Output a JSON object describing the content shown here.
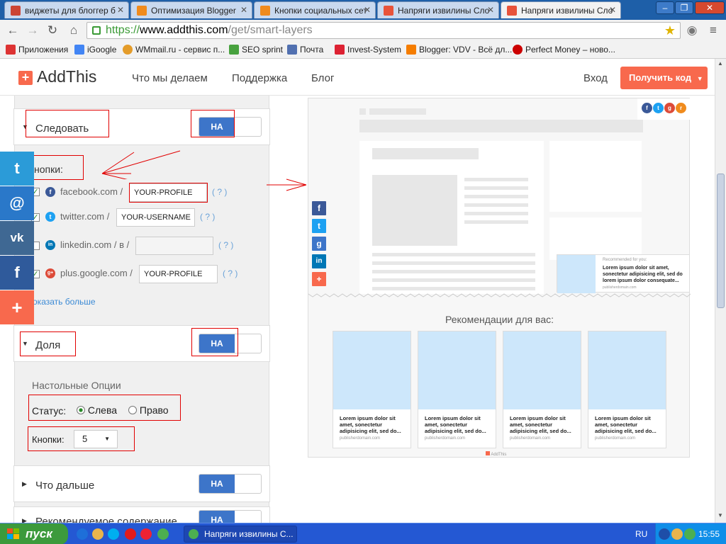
{
  "browser": {
    "tabs": [
      {
        "label": "виджеты для блоггер б",
        "fav": "#c43"
      },
      {
        "label": "Оптимизация Blogger",
        "fav": "#f08b1d"
      },
      {
        "label": "Кнопки социальных сет",
        "fav": "#f08b1d"
      },
      {
        "label": "Напряги извилины Сло",
        "fav": "#e8533a"
      },
      {
        "label": "Напряги извилины Сло",
        "fav": "#e8533a"
      }
    ],
    "url_https": "https://",
    "url_domain": "www.addthis.com",
    "url_path": "/get/smart-layers",
    "bookmarks": [
      {
        "label": "Приложения",
        "color": "#d33"
      },
      {
        "label": "iGoogle",
        "color": "#4285f4"
      },
      {
        "label": "WMmail.ru - сервис п...",
        "color": "#e49c2a"
      },
      {
        "label": "SEO sprint",
        "color": "#48a23f"
      },
      {
        "label": "Почта",
        "color": "#5170b0"
      },
      {
        "label": "Invest-System",
        "color": "#d23"
      },
      {
        "label": "Blogger: VDV - Всё дл...",
        "color": "#f57d00"
      },
      {
        "label": "Perfect Money – ново...",
        "color": "#c00"
      }
    ]
  },
  "header": {
    "logo": "AddThis",
    "nav": [
      "Что мы делаем",
      "Поддержка",
      "Блог"
    ],
    "login": "Вход",
    "cta": "Получить код"
  },
  "follow": {
    "title": "Следовать",
    "toggle": "НА",
    "buttons_label": "нопки:",
    "rows": [
      {
        "service": "facebook.com /",
        "value": "YOUR-PROFILE",
        "checked": true,
        "color": "#3b5998",
        "glyph": "f"
      },
      {
        "service": "twitter.com /",
        "value": "YOUR-USERNAME",
        "checked": true,
        "color": "#1da1f2",
        "glyph": "t"
      },
      {
        "service": "linkedin.com / в /",
        "value": "",
        "checked": false,
        "color": "#0077b5",
        "glyph": "in"
      },
      {
        "service": "plus.google.com /",
        "value": "YOUR-PROFILE",
        "checked": true,
        "color": "#dd4b39",
        "glyph": "g+"
      }
    ],
    "help": "( ? )",
    "show_more": "оказать больше"
  },
  "share": {
    "title": "Доля",
    "toggle": "НА",
    "desktop_title": "Настольные Опции",
    "status_label": "Статус:",
    "status_left": "Слева",
    "status_right": "Право",
    "buttons_label": "Кнопки:",
    "buttons_value": "5"
  },
  "whats_next": {
    "title": "Что дальше",
    "toggle": "НА"
  },
  "recommended": {
    "title": "Рекомендуемое содержание",
    "toggle": "НА"
  },
  "preview": {
    "rec_heading": "Рекомендации для вас:",
    "rec_small_title": "Recommended for you:",
    "rec_small_text": "Lorem ipsum dolor sit amet, sonectetur adipisicing elit, sed do lorem ipsum dolor consequate...",
    "rec_small_src": "publisherdomain.com",
    "card_text": "Lorem ipsum dolor sit amet, sonectetur adipisicing elit, sed do...",
    "card_src": "publisherdomain.com",
    "footer": "AddThis"
  },
  "taskbar": {
    "start": "пуск",
    "task": "Напряги извилины С...",
    "lang": "RU",
    "time": "15:55"
  }
}
